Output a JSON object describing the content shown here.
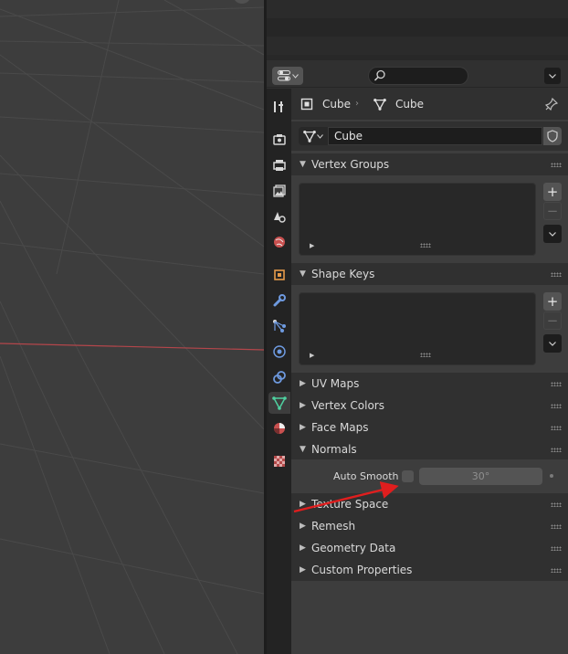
{
  "properties": {
    "breadcrumb": {
      "object_name": "Cube",
      "mesh_name": "Cube"
    },
    "data_block": {
      "mesh_name": "Cube"
    },
    "tabs": [
      {
        "name": "tool-icon"
      },
      {
        "name": "render-icon"
      },
      {
        "name": "output-icon"
      },
      {
        "name": "view-layer-icon"
      },
      {
        "name": "scene-icon"
      },
      {
        "name": "world-icon"
      },
      {
        "name": "object-icon"
      },
      {
        "name": "modifier-icon"
      },
      {
        "name": "particles-icon"
      },
      {
        "name": "physics-icon"
      },
      {
        "name": "constraints-icon"
      },
      {
        "name": "object-data-icon"
      },
      {
        "name": "material-icon"
      },
      {
        "name": "texture-icon"
      }
    ],
    "active_tab": "object-data-icon",
    "panels": {
      "vertex_groups": "Vertex Groups",
      "shape_keys": "Shape Keys",
      "uv_maps": "UV Maps",
      "vertex_colors": "Vertex Colors",
      "face_maps": "Face Maps",
      "normals": "Normals",
      "texture_space": "Texture Space",
      "remesh": "Remesh",
      "geometry_data": "Geometry Data",
      "custom_properties": "Custom Properties"
    },
    "normals": {
      "auto_smooth_label": "Auto Smooth",
      "auto_smooth_checked": false,
      "angle_value": "30°"
    },
    "list_buttons": {
      "add": "+",
      "remove": "−"
    }
  },
  "colors": {
    "accent_active_tab": "#3d3d3d",
    "viewport_x_axis": "#b4464b",
    "annotation_arrow": "#e01e1e"
  }
}
